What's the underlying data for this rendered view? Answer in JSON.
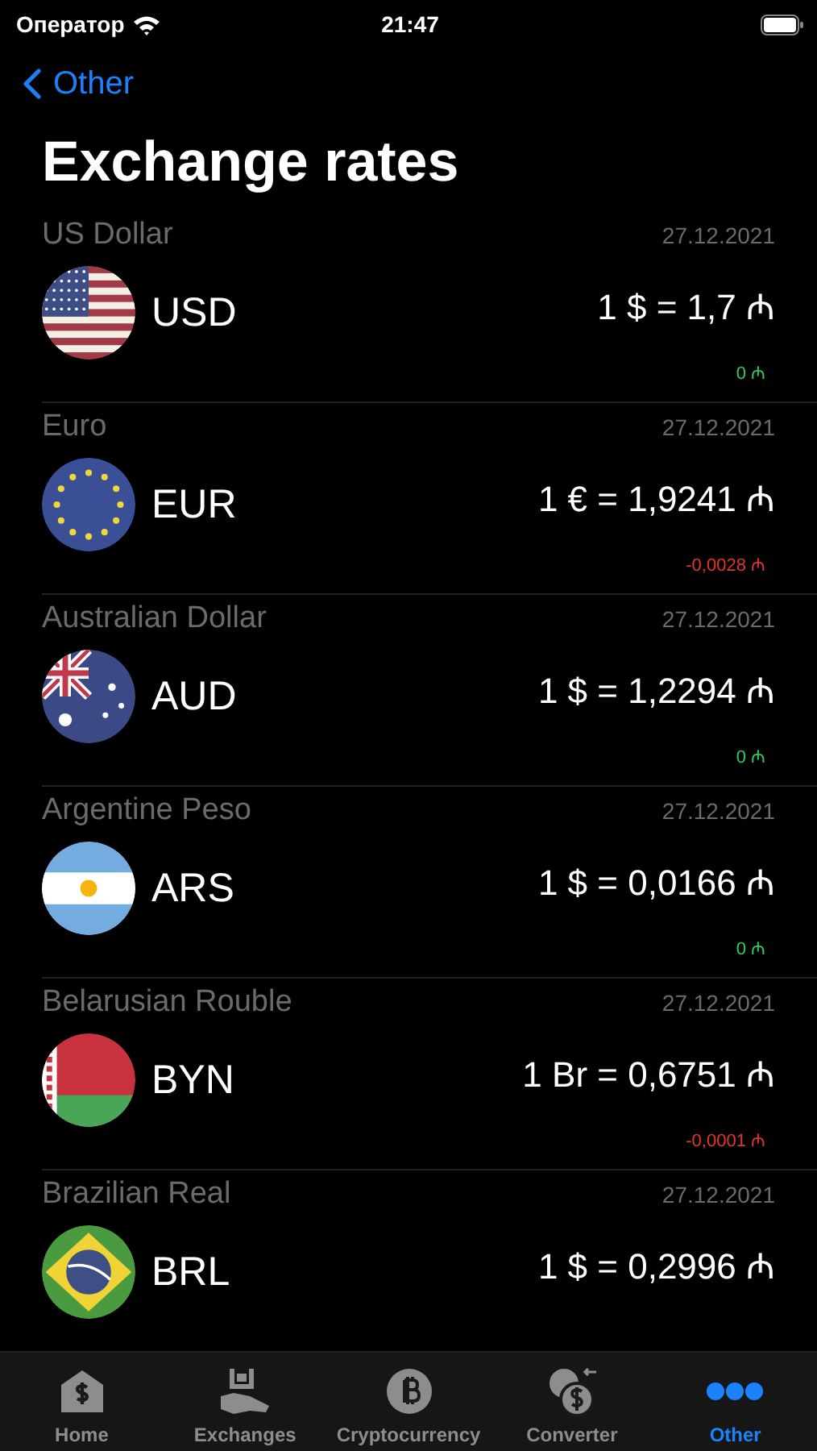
{
  "status_bar": {
    "carrier": "Оператор",
    "time": "21:47"
  },
  "nav": {
    "back_label": "Other"
  },
  "title": "Exchange rates",
  "rates": [
    {
      "name": "US Dollar",
      "date": "27.12.2021",
      "kind": "us",
      "code": "USD",
      "rate": "1 $ = 1,7 ₼",
      "change": "0 ₼",
      "color": "#34c759"
    },
    {
      "name": "Euro",
      "date": "27.12.2021",
      "kind": "eu",
      "code": "EUR",
      "rate": "1 € = 1,9241 ₼",
      "change": "-0,0028 ₼",
      "color": "#e0352b"
    },
    {
      "name": "Australian Dollar",
      "date": "27.12.2021",
      "kind": "au",
      "code": "AUD",
      "rate": "1 $ = 1,2294 ₼",
      "change": "0 ₼",
      "color": "#34c759"
    },
    {
      "name": "Argentine Peso",
      "date": "27.12.2021",
      "kind": "ar",
      "code": "ARS",
      "rate": "1 $ = 0,0166 ₼",
      "change": "0 ₼",
      "color": "#34c759"
    },
    {
      "name": "Belarusian Rouble",
      "date": "27.12.2021",
      "kind": "by",
      "code": "BYN",
      "rate": "1 Br = 0,6751 ₼",
      "change": "-0,0001 ₼",
      "color": "#e0352b"
    },
    {
      "name": "Brazilian Real",
      "date": "27.12.2021",
      "kind": "br",
      "code": "BRL",
      "rate": "1 $ = 0,2996 ₼"
    }
  ],
  "tabs": [
    {
      "kind": "home",
      "label": "Home",
      "selected": false
    },
    {
      "kind": "exchanges",
      "label": "Exchanges",
      "selected": false
    },
    {
      "kind": "crypto",
      "label": "Cryptocurrency",
      "selected": false
    },
    {
      "kind": "converter",
      "label": "Converter",
      "selected": false
    },
    {
      "kind": "other",
      "label": "Other",
      "selected": true
    }
  ]
}
